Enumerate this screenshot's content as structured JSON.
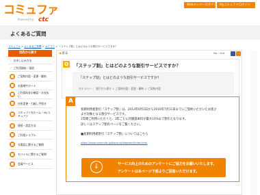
{
  "header": {
    "logo_text": "コミュファ",
    "logo_sub": "Powered by",
    "logo_ctc": "ctc",
    "web_member_button": "Webメンバーログイン",
    "my_commufa_button": "Myコミュファログイン"
  },
  "page": {
    "title": "よくあるご質問"
  },
  "breadcrumb": {
    "part1": "コミュファ",
    "sep1": " > ",
    "part2": "よくあるご質問",
    "sep2": " > ",
    "part3": "カテゴリ",
    "sep3": " > ",
    "current": "「ステップ割」とはどのような割引サービスですか？"
  },
  "sidebar": {
    "heading": "目的から探す",
    "items": [
      {
        "label": "お申し込み方法",
        "type": "sub"
      },
      {
        "label": "ご利用開始・接続",
        "type": "sub"
      },
      {
        "label": "ご契約内容・変更・解約",
        "type": "icon"
      },
      {
        "label": "お客様サポート",
        "type": "icon"
      },
      {
        "label": "ご利用料金の確認・お支払い",
        "type": "icon"
      },
      {
        "label": "住所変更・引越し手続き",
        "type": "icon"
      },
      {
        "label": "コミュファ光ホーム・Myコミュファ",
        "type": "icon2"
      },
      {
        "label": "接続・設定方法",
        "type": "icon"
      },
      {
        "label": "ご利用トラブル",
        "type": "icon"
      },
      {
        "label": "光電話に関するご質問",
        "type": "icon"
      },
      {
        "label": "モバイルに関するご質問",
        "type": "icon"
      },
      {
        "label": "会員サービス",
        "type": "icon"
      }
    ]
  },
  "main": {
    "back_label": "戻る",
    "number": "No : 104",
    "q_mark": "Q",
    "question": "「ステップ割」とはどのような割引サービスですか？",
    "question_sub": "「ステップ割」とはどのような割引サービスですか？",
    "category": "カテゴリー ： 割引から探す > ご契約内容・変更・解約 > ご契約内容",
    "a_mark": "A",
    "answer_lines": [
      "長期利用者割引「ステップ割」は、2012年6月1日から2016年7月31日までにご契約いただいたお客さ",
      "まが対象となる割引サービスです。",
      "2年間ご利用いただくと、3年ごとに月額基本料が最大10%まで割引となります。",
      "詳しくはステップ割のページをご覧ください。",
      "",
      "■長期利用者割引「ステップ割」についてはこちら"
    ],
    "answer_link": "https://www.commufa.jp/discount/stepwari/index.html"
  },
  "banner": {
    "icon": "↓",
    "line1": "サービス向上のためのアンケートにご協力をお願いいたします。",
    "line2": "アンケートは本ページ下部よりご回答いただけます。"
  }
}
